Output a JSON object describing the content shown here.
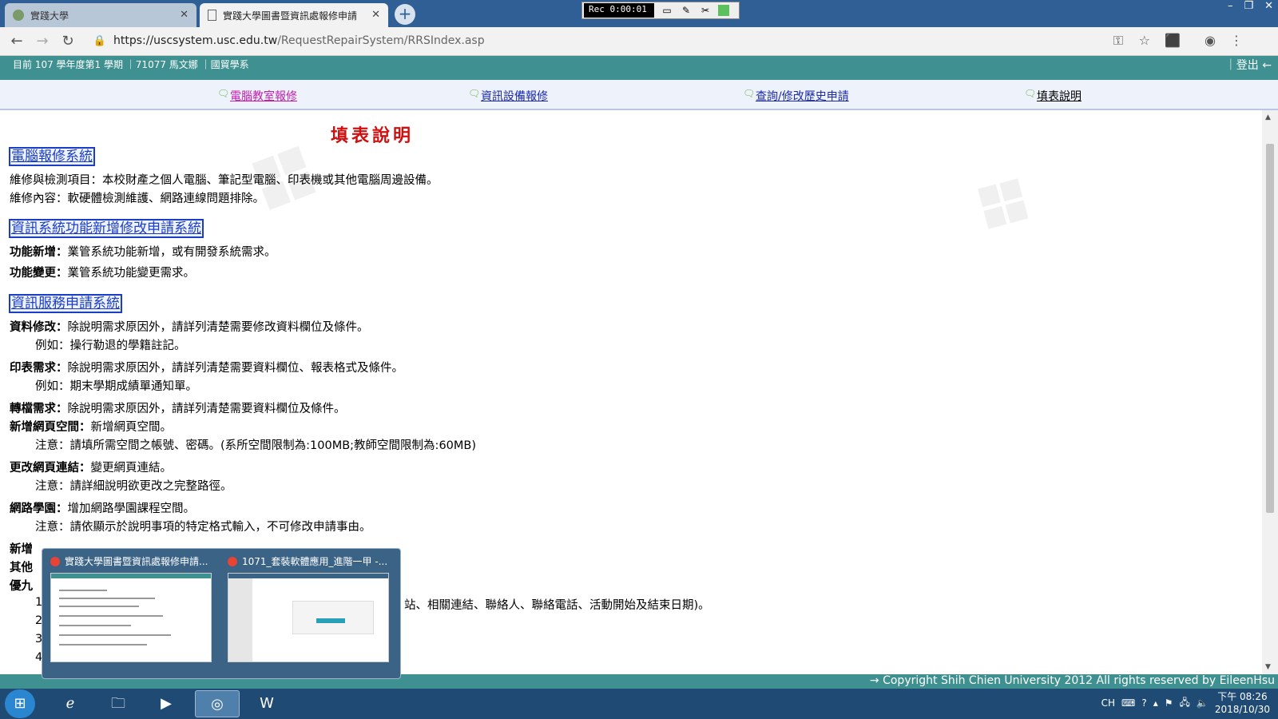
{
  "browser": {
    "tabs": [
      {
        "label": "實踐大學",
        "active": false
      },
      {
        "label": "實踐大學圖書暨資訊處報修申請",
        "active": true
      }
    ],
    "new_tab": "+",
    "recorder_time": "Rec 0:00:01",
    "window_controls": [
      "–",
      "❐",
      "✕"
    ],
    "url_host": "https://uscsystem.usc.edu.tw",
    "url_path": "/RequestRepairSystem/RRSIndex.asp"
  },
  "header": {
    "info": "目前 107 學年度第1 學期 ｜71077 馬文娜 ｜國貿學系",
    "logout": "｜登出 ←"
  },
  "menu": [
    {
      "label": "電腦教室報修",
      "color": "#c01fb0"
    },
    {
      "label": "資訊設備報修",
      "color": "#1a2ab0"
    },
    {
      "label": "查詢/修改歷史申請",
      "color": "#1a2ab0"
    },
    {
      "label": "填表說明",
      "color": "#000000"
    }
  ],
  "page": {
    "title": "填表說明",
    "sections": [
      "電腦報修系統",
      "資訊系統功能新增修改申請系統",
      "資訊服務申請系統"
    ],
    "lines": {
      "l1": "維修與檢測項目：本校財產之個人電腦、筆記型電腦、印表機或其他電腦周邊設備。",
      "l2": "維修內容：軟硬體檢測維護、網路連線問題排除。",
      "l3k": "功能新增：",
      "l3v": "業管系統功能新增，或有開發系統需求。",
      "l4k": "功能變更：",
      "l4v": "業管系統功能變更需求。",
      "l5k": "資料修改：",
      "l5v": "除說明需求原因外，請詳列清楚需要修改資料欄位及條件。",
      "l6": "例如：操行勒退的學籍註記。",
      "l7k": "印表需求：",
      "l7v": "除說明需求原因外，請詳列清楚需要資料欄位、報表格式及條件。",
      "l8": "例如：期末學期成績單通知單。",
      "l9k": "轉檔需求：",
      "l9v": "除說明需求原因外，請詳列清楚需要資料欄位及條件。",
      "l10k": "新增網頁空間：",
      "l10v": "新增網頁空間。",
      "l11": "注意：請填所需空間之帳號、密碼。(系所空間限制為:100MB;教師空間限制為:60MB)",
      "l12k": "更改網頁連結：",
      "l12v": "變更網頁連結。",
      "l13": "注意：請詳細說明欲更改之完整路徑。",
      "l14k": "網路學園：",
      "l14v": "增加網路學園課程空間。",
      "l15": "注意：請依顯示於說明事項的特定格式輸入，不可修改申請事由。",
      "l16": "新增",
      "l17": "其他",
      "l18": "優九",
      "l19": "站、相關連結、聯絡人、聯絡電話、活動開始及結束日期)。",
      "n1": "1",
      "n2": "2",
      "n3": "3",
      "n4": "4"
    }
  },
  "footer": "→ Copyright Shih Chien University 2012 All rights reserved by EileenHsu",
  "taskbar": {
    "popup": [
      {
        "title": "實踐大學圖書暨資訊處報修申請..."
      },
      {
        "title": "1071_套裝軟體應用_進階一甲 -..."
      }
    ],
    "tray_lang": "CH",
    "clock_time": "下午 08:26",
    "clock_date": "2018/10/30"
  }
}
